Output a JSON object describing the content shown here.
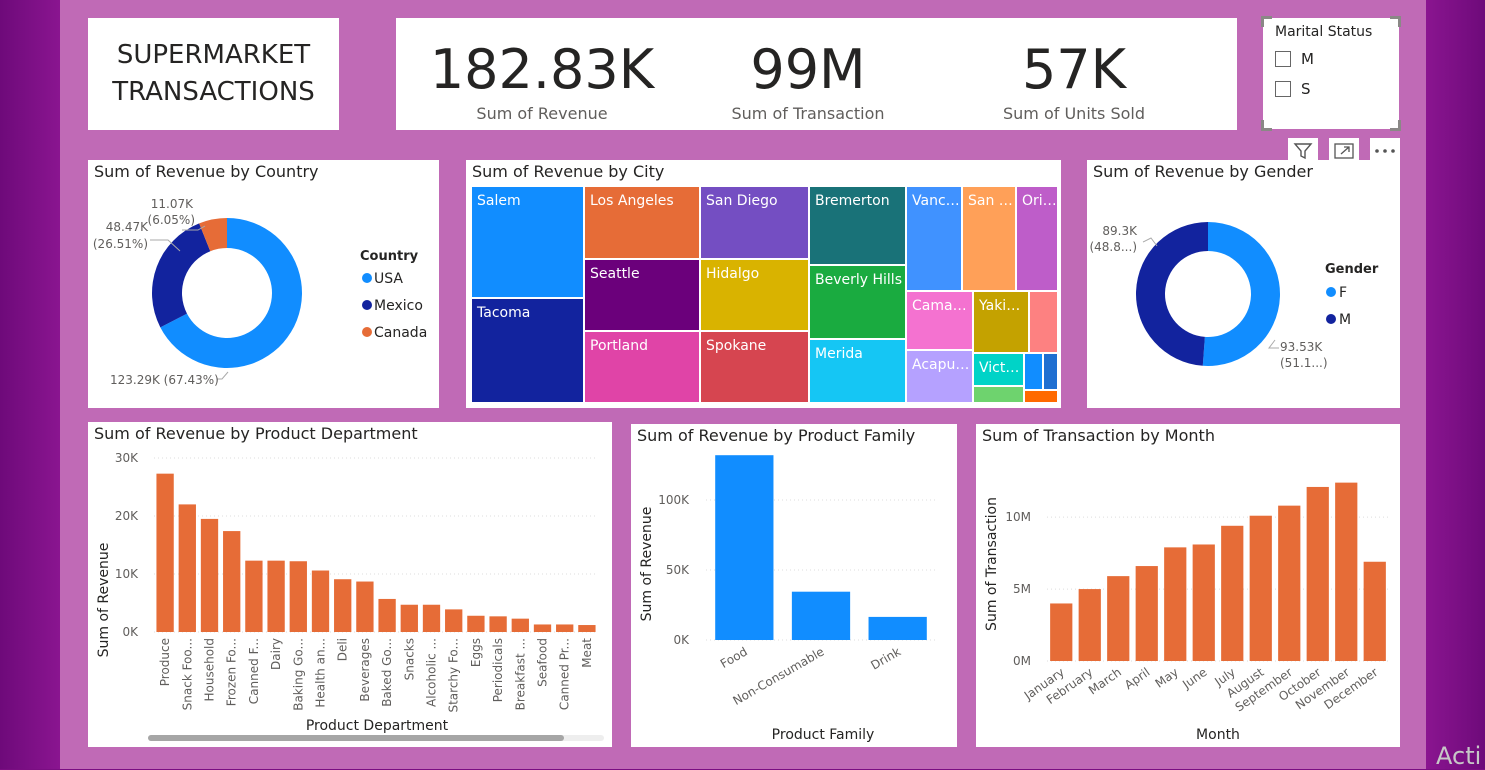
{
  "dashboard": {
    "title_line1": "SUPERMARKET",
    "title_line2": "TRANSACTIONS"
  },
  "kpis": [
    {
      "value": "182.83K",
      "label": "Sum of Revenue"
    },
    {
      "value": "99M",
      "label": "Sum of Transaction"
    },
    {
      "value": "57K",
      "label": "Sum of Units Sold"
    }
  ],
  "slicer": {
    "title": "Marital Status",
    "options": [
      "M",
      "S"
    ]
  },
  "colors": {
    "blue": "#118dff",
    "navy": "#12239e",
    "orange": "#e66c37",
    "canvas": "#c06ab6"
  },
  "watermark": "Acti",
  "chart_data": [
    {
      "id": "country",
      "type": "pie",
      "title": "Sum of Revenue by Country",
      "legend_title": "Country",
      "legend_position": "right",
      "slices": [
        {
          "label": "USA",
          "value": 123290,
          "pct": 67.43,
          "text": "123.29K (67.43%)",
          "color": "#118dff"
        },
        {
          "label": "Mexico",
          "value": 48470,
          "pct": 26.51,
          "text": "48.47K (26.51%)",
          "color": "#12239e"
        },
        {
          "label": "Canada",
          "value": 11070,
          "pct": 6.05,
          "text": "11.07K (6.05%)",
          "color": "#e66c37"
        }
      ]
    },
    {
      "id": "city",
      "type": "treemap",
      "title": "Sum of Revenue by City",
      "cells": [
        {
          "label": "Salem",
          "color": "#118dff"
        },
        {
          "label": "Tacoma",
          "color": "#12239e"
        },
        {
          "label": "Los Angeles",
          "color": "#e66c37"
        },
        {
          "label": "Seattle",
          "color": "#6b007b"
        },
        {
          "label": "Portland",
          "color": "#e044a7"
        },
        {
          "label": "San Diego",
          "color": "#744ec2"
        },
        {
          "label": "Hidalgo",
          "color": "#d9b300"
        },
        {
          "label": "Spokane",
          "color": "#d64550"
        },
        {
          "label": "Bremerton",
          "color": "#197278"
        },
        {
          "label": "Beverly Hills",
          "color": "#1aab40"
        },
        {
          "label": "Merida",
          "color": "#15c6f4"
        },
        {
          "label": "Vancouver",
          "color": "#4092ff"
        },
        {
          "label": "San Francisco",
          "color": "#ffa058"
        },
        {
          "label": "Orizaba",
          "color": "#be5dc9"
        },
        {
          "label": "Camacho",
          "color": "#f472d0"
        },
        {
          "label": "Yakima",
          "color": "#c4a200"
        },
        {
          "label": "",
          "color": "#fd8181"
        },
        {
          "label": "Acapulco",
          "color": "#b5a1ff"
        },
        {
          "label": "Victoria",
          "color": "#00d3c7"
        },
        {
          "label": "",
          "color": "#118dff"
        },
        {
          "label": "",
          "color": "#1f6fd1"
        },
        {
          "label": "",
          "color": "#6ed36e"
        },
        {
          "label": "",
          "color": "#ff6a00"
        }
      ]
    },
    {
      "id": "gender",
      "type": "pie",
      "title": "Sum of Revenue by Gender",
      "legend_title": "Gender",
      "legend_position": "right",
      "slices": [
        {
          "label": "F",
          "value": 93530,
          "pct": 51.15,
          "text1": "93.53K",
          "text2": "(51.1...)",
          "color": "#118dff"
        },
        {
          "label": "M",
          "value": 89300,
          "pct": 48.85,
          "text1": "89.3K",
          "text2": "(48.8...)",
          "color": "#12239e"
        }
      ]
    },
    {
      "id": "department",
      "type": "bar",
      "title": "Sum of Revenue by Product Department",
      "xlabel": "Product Department",
      "ylabel": "Sum of Revenue",
      "ylim": [
        0,
        30000
      ],
      "yticks": [
        "0K",
        "10K",
        "20K",
        "30K"
      ],
      "grid": true,
      "color": "#e66c37",
      "categories": [
        "Produce",
        "Snack Foo...",
        "Household",
        "Frozen Fo...",
        "Canned F...",
        "Dairy",
        "Baking Go...",
        "Health an...",
        "Deli",
        "Beverages",
        "Baked Go...",
        "Snacks",
        "Alcoholic ...",
        "Starchy Fo...",
        "Eggs",
        "Periodicals",
        "Breakfast ...",
        "Seafood",
        "Canned Pr...",
        "Meat"
      ],
      "values": [
        27300,
        22000,
        19500,
        17400,
        12300,
        12300,
        12200,
        10600,
        9100,
        8700,
        5700,
        4700,
        4700,
        3900,
        2800,
        2700,
        2300,
        1300,
        1300,
        1200
      ]
    },
    {
      "id": "family",
      "type": "bar",
      "title": "Sum of Revenue by Product Family",
      "xlabel": "Product Family",
      "ylabel": "Sum of Revenue",
      "ylim": [
        0,
        140000
      ],
      "yticks": [
        "0K",
        "50K",
        "100K"
      ],
      "grid": true,
      "color": "#118dff",
      "categories": [
        "Food",
        "Non-Consumable",
        "Drink"
      ],
      "values": [
        132000,
        34500,
        16500
      ]
    },
    {
      "id": "month",
      "type": "bar",
      "title": "Sum of Transaction by Month",
      "xlabel": "Month",
      "ylabel": "Sum of Transaction",
      "ylim": [
        0,
        13000000
      ],
      "yticks": [
        "0M",
        "5M",
        "10M"
      ],
      "grid": true,
      "color": "#e66c37",
      "categories": [
        "January",
        "February",
        "March",
        "April",
        "May",
        "June",
        "July",
        "August",
        "September",
        "October",
        "November",
        "December"
      ],
      "values": [
        4000000,
        5000000,
        5900000,
        6600000,
        7900000,
        8100000,
        9400000,
        10100000,
        10800000,
        12100000,
        12400000,
        6900000
      ]
    }
  ]
}
